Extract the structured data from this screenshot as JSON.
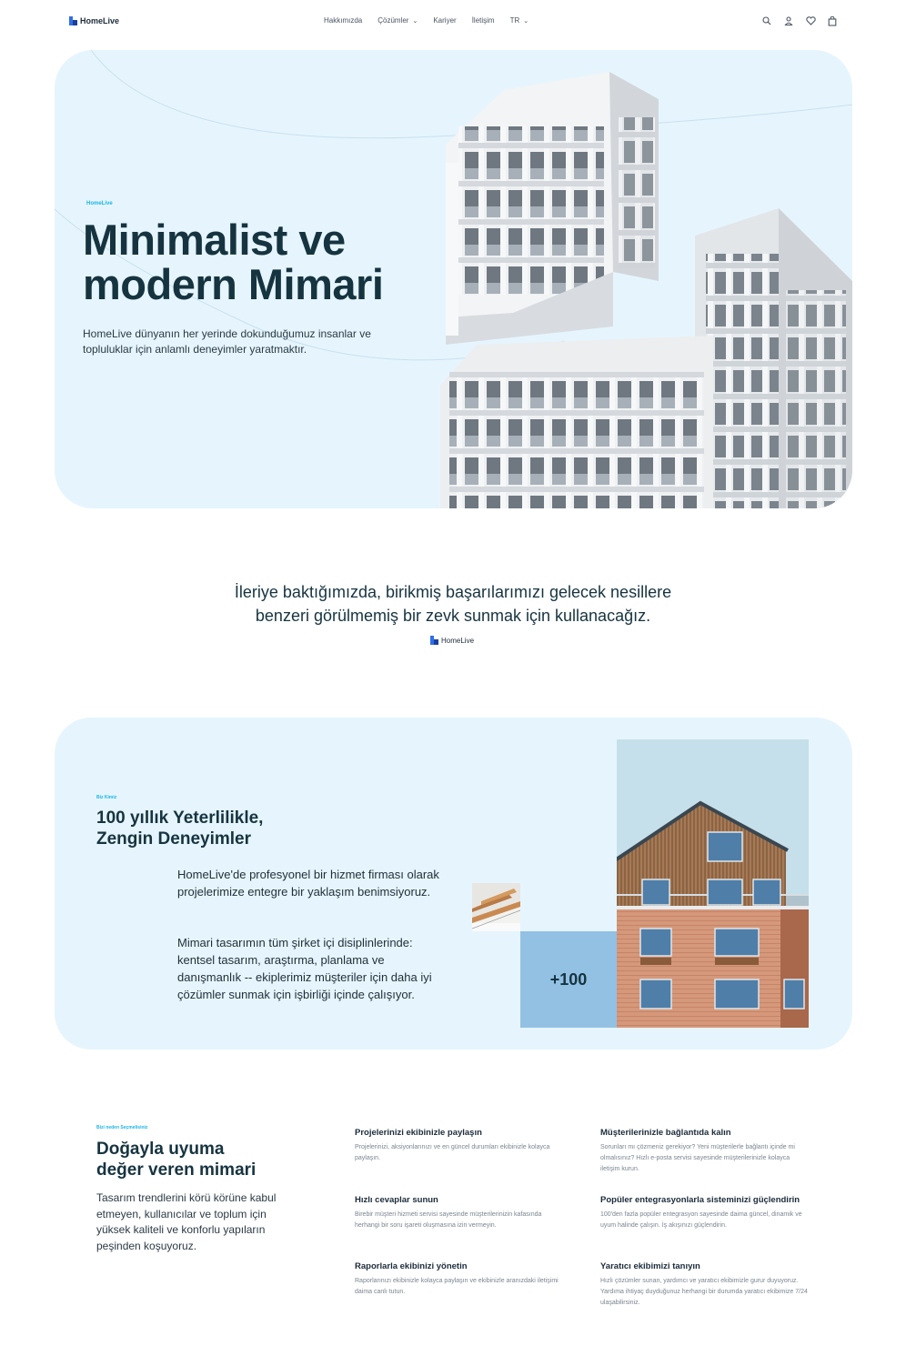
{
  "nav": {
    "brand": "HomeLive",
    "links": [
      {
        "label": "Hakkımızda"
      },
      {
        "label": "Çözümler",
        "dropdown": true
      },
      {
        "label": "Kariyer"
      },
      {
        "label": "İletişim"
      },
      {
        "label": "TR",
        "dropdown": true
      }
    ],
    "icons": [
      "search-icon",
      "user-icon",
      "heart-icon",
      "bag-icon"
    ]
  },
  "hero": {
    "eyebrow": "HomeLive",
    "title_line1": "Minimalist ve",
    "title_line2": "modern Mimari",
    "subtitle": "HomeLive dünyanın her yerinde dokunduğumuz insanlar ve topluluklar için anlamlı deneyimler yaratmaktır."
  },
  "quote": {
    "text_line1": "İleriye baktığımızda, birikmiş başarılarımızı gelecek nesillere",
    "text_line2": "benzeri görülmemiş bir zevk sunmak için kullanacağız.",
    "brand": "HomeLive"
  },
  "about": {
    "eyebrow": "Biz Kimiz",
    "title_line1": "100 yıllık Yeterlilikle,",
    "title_line2": "Zengin Deneyimler",
    "paragraph1": "HomeLive'de profesyonel bir hizmet firması olarak projelerimize entegre bir yaklaşım benimsiyoruz.",
    "paragraph2": "Mimari tasarımın tüm şirket içi disiplinlerinde: kentsel tasarım, araştırma, planlama ve danışmanlık -- ekiplerimiz müşteriler için daha iyi çözümler sunmak için işbirliği içinde çalışıyor.",
    "stat": "+100"
  },
  "why": {
    "eyebrow": "Bizi neden Seçmelisiniz",
    "title_line1": "Doğayla uyuma",
    "title_line2": "değer veren mimari",
    "paragraph": "Tasarım trendlerini körü körüne kabul etmeyen, kullanıcılar ve toplum için yüksek kaliteli ve konforlu yapıların peşinden koşuyoruz.",
    "features": [
      {
        "title": "Projelerinizi ekibinizle paylaşın",
        "text": "Projelerinizi, aksiyonlarınızı ve en güncel durumları ekibinizle kolayca paylaşın."
      },
      {
        "title": "Müşterilerinizle bağlantıda kalın",
        "text": "Sorunları mı çözmeniz gerekiyor? Yeni müşterilerle bağlantı içinde mi olmalısınız? Hızlı e-posta servisi sayesinde müşterilerinizle kolayca iletişim kurun."
      },
      {
        "title": "Hızlı cevaplar sunun",
        "text": "Birebir müşteri hizmeti servisi sayesinde müşterilerinizin kafasında herhangi bir soru işareti oluşmasına izin vermeyin."
      },
      {
        "title": "Popüler entegrasyonlarla sisteminizi güçlendirin",
        "text": "100'den fazla popüler entegrasyon sayesinde daima güncel, dinamik ve uyum halinde çalışın. İş akışınızı güçlendirin."
      },
      {
        "title": "Raporlarla ekibinizi yönetin",
        "text": "Raporlarınızı ekibinizle kolayca paylaşın ve ekibinizle aranızdaki iletişimi daima canlı tutun."
      },
      {
        "title": "Yaratıcı ekibimizi tanıyın",
        "text": "Hızlı çözümler sunan, yardımcı ve yaratıcı ekibimizle gurur duyuyoruz. Yardıma ihtiyaç duyduğunuz herhangi bir durumda yaratıcı ekibimize 7/24 ulaşabilirsiniz."
      }
    ]
  }
}
